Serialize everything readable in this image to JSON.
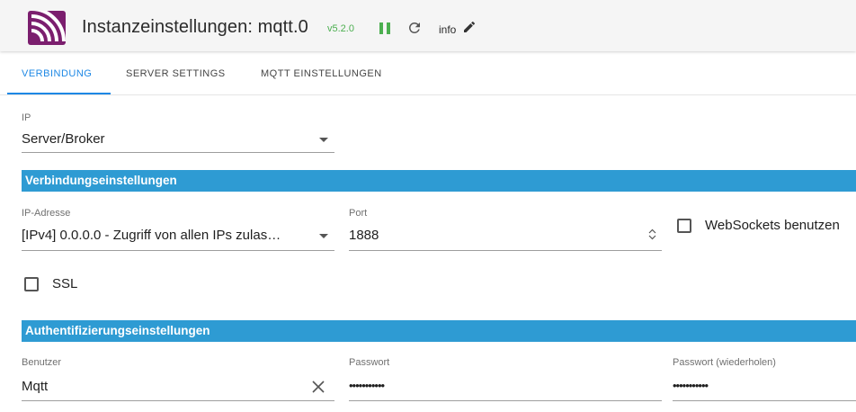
{
  "header": {
    "title": "Instanzeinstellungen: mqtt.0",
    "version": "v5.2.0",
    "info_label": "info",
    "colors": {
      "brand": "#7b1e6e",
      "running": "#4caf50",
      "accent": "#1e88e5",
      "section": "#2e9bd3"
    },
    "icons": {
      "logo": "iobroker-mqtt-logo",
      "pause": "pause-icon",
      "reload": "reload-icon",
      "edit": "pencil-icon"
    }
  },
  "tabs": [
    {
      "label": "VERBINDUNG",
      "active": true
    },
    {
      "label": "SERVER SETTINGS",
      "active": false
    },
    {
      "label": "MQTT EINSTELLUNGEN",
      "active": false
    }
  ],
  "ip": {
    "label": "IP",
    "value": "Server/Broker"
  },
  "connection": {
    "section_title": "Verbindungseinstellungen",
    "ip_address": {
      "label": "IP-Adresse",
      "value": "[IPv4] 0.0.0.0 - Zugriff von allen IPs zulas…"
    },
    "port": {
      "label": "Port",
      "value": "1888"
    },
    "websockets": {
      "label": "WebSockets benutzen",
      "checked": false
    },
    "ssl": {
      "label": "SSL",
      "checked": false
    }
  },
  "auth": {
    "section_title": "Authentifizierungseinstellungen",
    "user": {
      "label": "Benutzer",
      "value": "Mqtt"
    },
    "password": {
      "label": "Passwort",
      "value": "•••••••••••"
    },
    "password_repeat": {
      "label": "Passwort (wiederholen)",
      "value": "•••••••••••"
    }
  }
}
